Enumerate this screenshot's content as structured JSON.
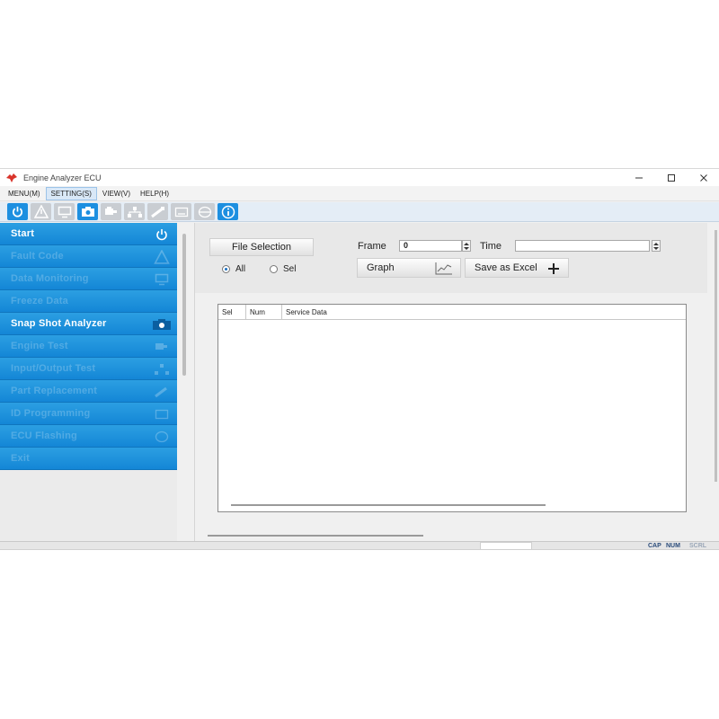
{
  "window": {
    "title": "Engine Analyzer ECU"
  },
  "menu": [
    {
      "label": "MENU(M)",
      "active": false
    },
    {
      "label": "SETTING(S)",
      "active": true
    },
    {
      "label": "VIEW(V)",
      "active": false
    },
    {
      "label": "HELP(H)",
      "active": false
    }
  ],
  "toolbar": [
    {
      "icon": "power-icon",
      "on": true
    },
    {
      "icon": "warning-icon",
      "on": false
    },
    {
      "icon": "monitor-icon",
      "on": false
    },
    {
      "icon": "camera-icon",
      "on": true
    },
    {
      "icon": "engine-icon",
      "on": false
    },
    {
      "icon": "network-icon",
      "on": false
    },
    {
      "icon": "injector-icon",
      "on": false
    },
    {
      "icon": "keyboard-icon",
      "on": false
    },
    {
      "icon": "disc-icon",
      "on": false
    },
    {
      "icon": "info-icon",
      "on": true
    }
  ],
  "sidebar": {
    "items": [
      {
        "label": "Start",
        "icon": "power-icon",
        "dim": false
      },
      {
        "label": "Fault Code",
        "icon": "warning-icon",
        "dim": true
      },
      {
        "label": "Data Monitoring",
        "icon": "monitor-icon",
        "dim": true
      },
      {
        "label": "Freeze Data",
        "icon": "",
        "dim": true
      },
      {
        "label": "Snap Shot Analyzer",
        "icon": "camera-icon",
        "dim": false
      },
      {
        "label": "Engine Test",
        "icon": "engine-icon",
        "dim": true
      },
      {
        "label": "Input/Output Test",
        "icon": "network-icon",
        "dim": true
      },
      {
        "label": "Part Replacement",
        "icon": "injector-icon",
        "dim": true
      },
      {
        "label": "ID Programming",
        "icon": "keyboard-icon",
        "dim": true
      },
      {
        "label": "ECU Flashing",
        "icon": "disc-icon",
        "dim": true
      },
      {
        "label": "Exit",
        "icon": "",
        "dim": true
      }
    ]
  },
  "main": {
    "file_selection_label": "File Selection",
    "radio_all": "All",
    "radio_sel": "Sel",
    "frame_label": "Frame",
    "frame_value": "0",
    "time_label": "Time",
    "time_value": "",
    "graph_label": "Graph",
    "save_excel_label": "Save as Excel",
    "table": {
      "columns": [
        "Sel",
        "Num",
        "Service Data"
      ],
      "rows": []
    }
  },
  "status": {
    "cap": "CAP",
    "num": "NUM",
    "scrl": "SCRL"
  },
  "colors": {
    "accent": "#1486d6",
    "toolbar_on": "#1d8fe0"
  }
}
